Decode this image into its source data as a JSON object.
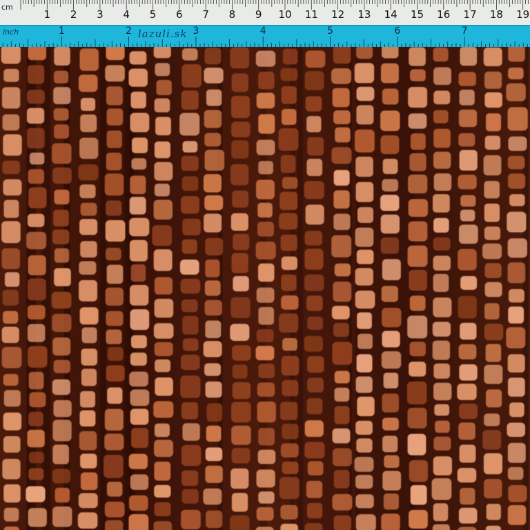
{
  "ruler": {
    "cm_unit_label": "cm",
    "inch_unit_label": "inch",
    "brand_label": "lazuli.sk",
    "cm_ticks": [
      "1",
      "2",
      "3",
      "4",
      "5",
      "6",
      "7",
      "8",
      "9",
      "10",
      "11",
      "12",
      "13",
      "14",
      "15",
      "16",
      "17",
      "18",
      "19",
      "2"
    ],
    "inch_ticks": [
      "1",
      "2",
      "3",
      "4",
      "5",
      "6",
      "7"
    ]
  },
  "fabric": {
    "description_colors": {
      "background": "#3b1206",
      "dark": "#220803",
      "square_light": "#e0956a",
      "square_mid": "#c46a3e",
      "square_dark": "#8f3f1d"
    },
    "columns": 21,
    "rows": 23
  }
}
